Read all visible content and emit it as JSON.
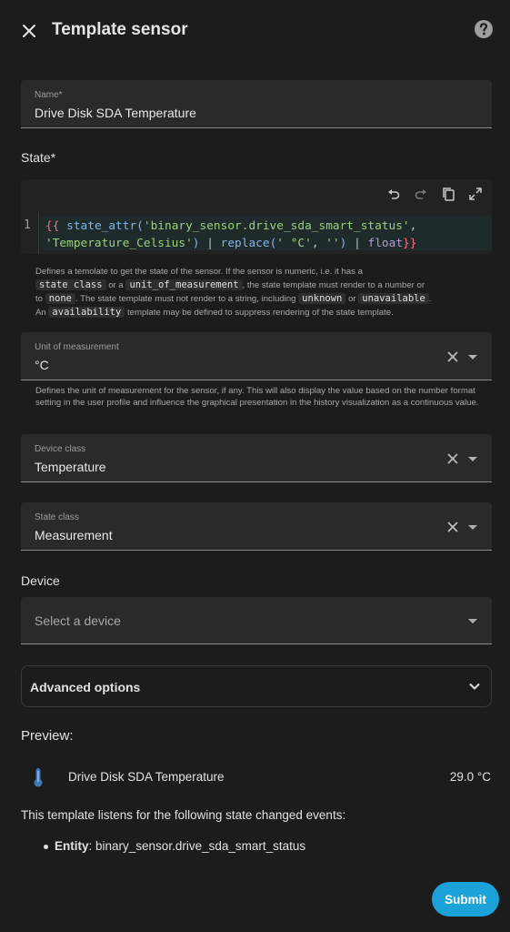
{
  "dialog": {
    "title": "Template sensor"
  },
  "name_field": {
    "label": "Name*",
    "value": "Drive Disk SDA Temperature"
  },
  "state": {
    "label": "State*",
    "line_number": "1",
    "code": {
      "open": "{{",
      "fn1": " state_attr(",
      "arg1": "'binary_sensor.drive_sda_smart_status'",
      "comma": ",",
      "arg2": "'Temperature_Celsius'",
      "rest1": ") ",
      "pipe1": "|",
      "replace": " replace(",
      "arg3": "' °C'",
      "comma2": ", ",
      "arg4": "''",
      "rest2": ") ",
      "pipe2": "|",
      "float": " float",
      "close": "}}"
    },
    "helper": {
      "p1": "Defines a temolate to get the state of the sensor. If the sensor is numeric, i.e. it has a",
      "c1": "state class",
      "p2": "or a",
      "c2": "unit_of_measurement",
      "p3": ", the state template must render to a number or",
      "p4": "to",
      "c3": "none",
      "p5": ". The state template must not render to a string, including",
      "c4": "unknown",
      "p6": "or",
      "c5": "unavailable",
      "p7": ".",
      "p8": "An",
      "c6": "availability",
      "p9": "template may be defined to suppress rendering of the state template."
    }
  },
  "unit_field": {
    "label": "Unit of measurement",
    "value": "°C",
    "helper": "Defines the unit of measurement for the sensor, if any. This will also display the value based on the number format setting in the user profile and influence the graphical presentation in the history visualization as a continuous value."
  },
  "device_class_field": {
    "label": "Device class",
    "value": "Temperature"
  },
  "state_class_field": {
    "label": "State class",
    "value": "Measurement"
  },
  "device": {
    "label": "Device",
    "placeholder": "Select a device"
  },
  "advanced": {
    "label": "Advanced options"
  },
  "preview": {
    "title": "Preview:",
    "entity_name": "Drive Disk SDA Temperature",
    "entity_value": "29.0 °C",
    "listen_text": "This template listens for the following state changed events:",
    "entity_label": "Entity",
    "entity_id": ": binary_sensor.drive_sda_smart_status"
  },
  "actions": {
    "submit": "Submit"
  },
  "colors": {
    "accent": "#1ba3d9",
    "background": "#1c1c1c",
    "field_bg": "#2a2a2a"
  },
  "icons": {
    "close": "close-icon",
    "help": "help-circle-icon",
    "undo": "undo-icon",
    "redo": "redo-icon",
    "copy": "copy-icon",
    "fullscreen": "fullscreen-icon",
    "clear": "clear-icon",
    "dropdown": "dropdown-icon",
    "chevron": "chevron-down-icon",
    "thermometer": "thermometer-icon"
  }
}
